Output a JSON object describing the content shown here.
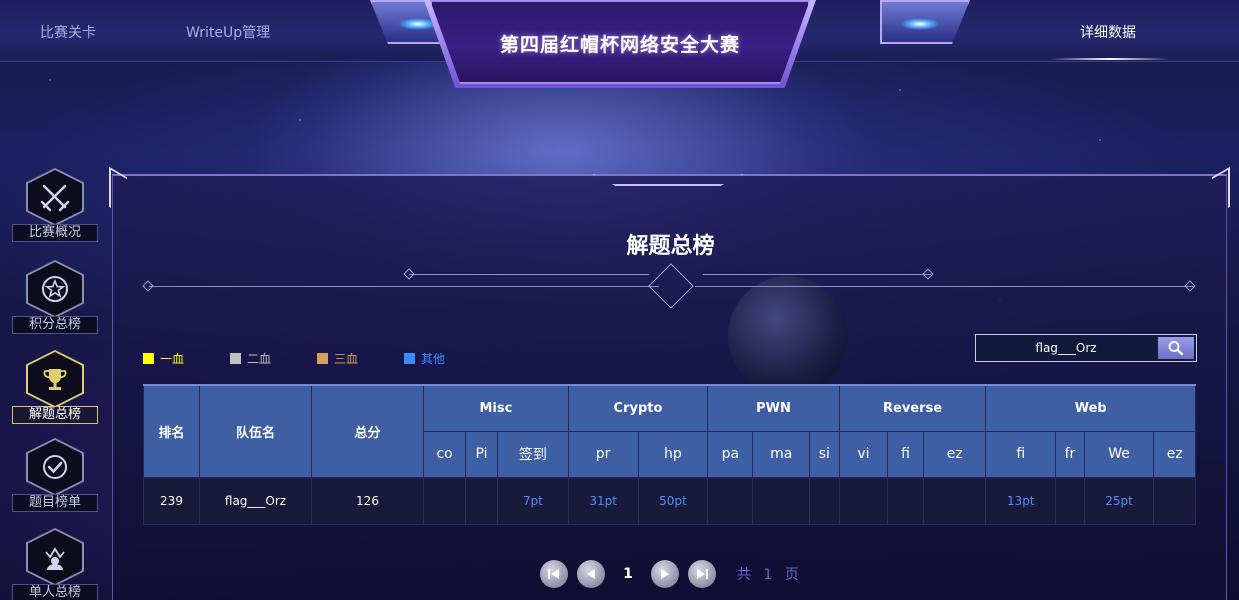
{
  "nav": {
    "match_label": "比赛关卡",
    "writeup_label": "WriteUp管理",
    "details_label": "详细数据",
    "site_title": "第四届红帽杯网络安全大赛"
  },
  "sidebar": {
    "items": [
      {
        "label": "比赛概况",
        "icon": "swords-icon"
      },
      {
        "label": "积分总榜",
        "icon": "star-badge-icon"
      },
      {
        "label": "解题总榜",
        "icon": "trophy-icon",
        "active": true
      },
      {
        "label": "题目榜单",
        "icon": "check-icon"
      },
      {
        "label": "单人总榜",
        "icon": "crown-person-icon"
      }
    ]
  },
  "main": {
    "title": "解题总榜",
    "legend": [
      {
        "label": "一血",
        "color": "#ffff00"
      },
      {
        "label": "二血",
        "color": "#c0c0c0"
      },
      {
        "label": "三血",
        "color": "#d9a055"
      },
      {
        "label": "其他",
        "color": "#3b8cff"
      }
    ],
    "search": {
      "value": "flag___Orz"
    }
  },
  "table": {
    "col_rank": "排名",
    "col_team": "队伍名",
    "col_total": "总分",
    "categories": [
      {
        "name": "Misc",
        "challenges": [
          "co",
          "Pi",
          "签到"
        ]
      },
      {
        "name": "Crypto",
        "challenges": [
          "pr",
          "hp"
        ]
      },
      {
        "name": "PWN",
        "challenges": [
          "pa",
          "ma",
          "si"
        ]
      },
      {
        "name": "Reverse",
        "challenges": [
          "vi",
          "fi",
          "ez"
        ]
      },
      {
        "name": "Web",
        "challenges": [
          "fi",
          "fr",
          "We",
          "ez"
        ]
      }
    ],
    "rows": [
      {
        "rank": "239",
        "team": "flag___Orz",
        "total": "126",
        "scores": [
          "",
          "",
          "7pt",
          "31pt",
          "50pt",
          "",
          "",
          "",
          "",
          "",
          "",
          "13pt",
          "",
          "25pt",
          ""
        ]
      }
    ]
  },
  "pager": {
    "current": "1",
    "total_text": "共 1 页"
  }
}
